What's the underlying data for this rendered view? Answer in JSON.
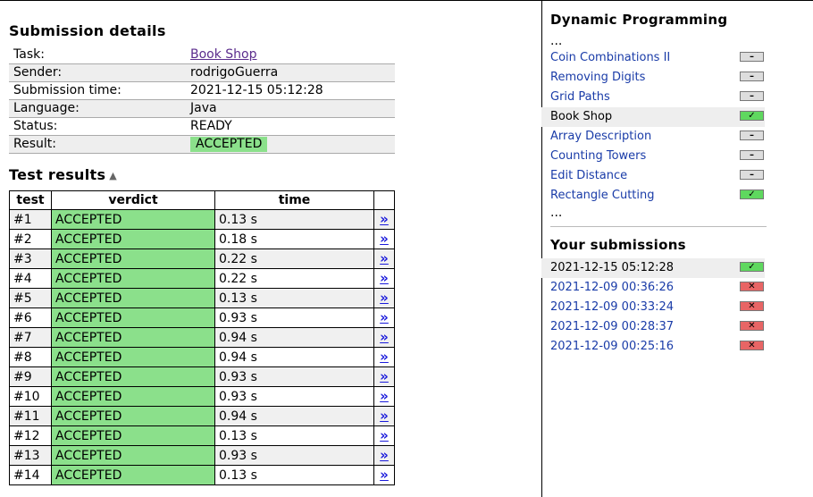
{
  "submission": {
    "title": "Submission details",
    "rows": [
      {
        "k": "Task:",
        "v": "Book Shop",
        "link": true
      },
      {
        "k": "Sender:",
        "v": "rodrigoGuerra"
      },
      {
        "k": "Submission time:",
        "v": "2021-12-15 05:12:28"
      },
      {
        "k": "Language:",
        "v": "Java"
      },
      {
        "k": "Status:",
        "v": "READY"
      },
      {
        "k": "Result:",
        "v": "ACCEPTED",
        "badge": true
      }
    ]
  },
  "tests": {
    "title": "Test results",
    "sort_icon": "triangle-up-icon",
    "headers": [
      "test",
      "verdict",
      "time",
      ""
    ],
    "link_glyph": "»",
    "rows": [
      {
        "test": "#1",
        "verdict": "ACCEPTED",
        "time": "0.13 s"
      },
      {
        "test": "#2",
        "verdict": "ACCEPTED",
        "time": "0.18 s"
      },
      {
        "test": "#3",
        "verdict": "ACCEPTED",
        "time": "0.22 s"
      },
      {
        "test": "#4",
        "verdict": "ACCEPTED",
        "time": "0.22 s"
      },
      {
        "test": "#5",
        "verdict": "ACCEPTED",
        "time": "0.13 s"
      },
      {
        "test": "#6",
        "verdict": "ACCEPTED",
        "time": "0.93 s"
      },
      {
        "test": "#7",
        "verdict": "ACCEPTED",
        "time": "0.94 s"
      },
      {
        "test": "#8",
        "verdict": "ACCEPTED",
        "time": "0.94 s"
      },
      {
        "test": "#9",
        "verdict": "ACCEPTED",
        "time": "0.93 s"
      },
      {
        "test": "#10",
        "verdict": "ACCEPTED",
        "time": "0.93 s"
      },
      {
        "test": "#11",
        "verdict": "ACCEPTED",
        "time": "0.94 s"
      },
      {
        "test": "#12",
        "verdict": "ACCEPTED",
        "time": "0.13 s"
      },
      {
        "test": "#13",
        "verdict": "ACCEPTED",
        "time": "0.93 s"
      },
      {
        "test": "#14",
        "verdict": "ACCEPTED",
        "time": "0.13 s"
      }
    ]
  },
  "sidebar": {
    "section_title": "Dynamic Programming",
    "ellipsis": "...",
    "tasks": [
      {
        "name": "Coin Combinations II",
        "status": "dash"
      },
      {
        "name": "Removing Digits",
        "status": "dash"
      },
      {
        "name": "Grid Paths",
        "status": "dash"
      },
      {
        "name": "Book Shop",
        "status": "ok",
        "current": true
      },
      {
        "name": "Array Description",
        "status": "dash"
      },
      {
        "name": "Counting Towers",
        "status": "dash"
      },
      {
        "name": "Edit Distance",
        "status": "dash"
      },
      {
        "name": "Rectangle Cutting",
        "status": "ok"
      }
    ],
    "submissions_title": "Your submissions",
    "submissions": [
      {
        "time": "2021-12-15 05:12:28",
        "status": "ok",
        "current": true
      },
      {
        "time": "2021-12-09 00:36:26",
        "status": "bad"
      },
      {
        "time": "2021-12-09 00:33:24",
        "status": "bad"
      },
      {
        "time": "2021-12-09 00:28:37",
        "status": "bad"
      },
      {
        "time": "2021-12-09 00:25:16",
        "status": "bad"
      }
    ]
  },
  "icons": {
    "dash": "–",
    "ok": "✓",
    "bad": "✕"
  },
  "colors": {
    "accepted": "#8be08b",
    "ok": "#5fd85f",
    "bad": "#e86565",
    "link": "#1a3ca8",
    "visited": "#5b2c8d"
  }
}
